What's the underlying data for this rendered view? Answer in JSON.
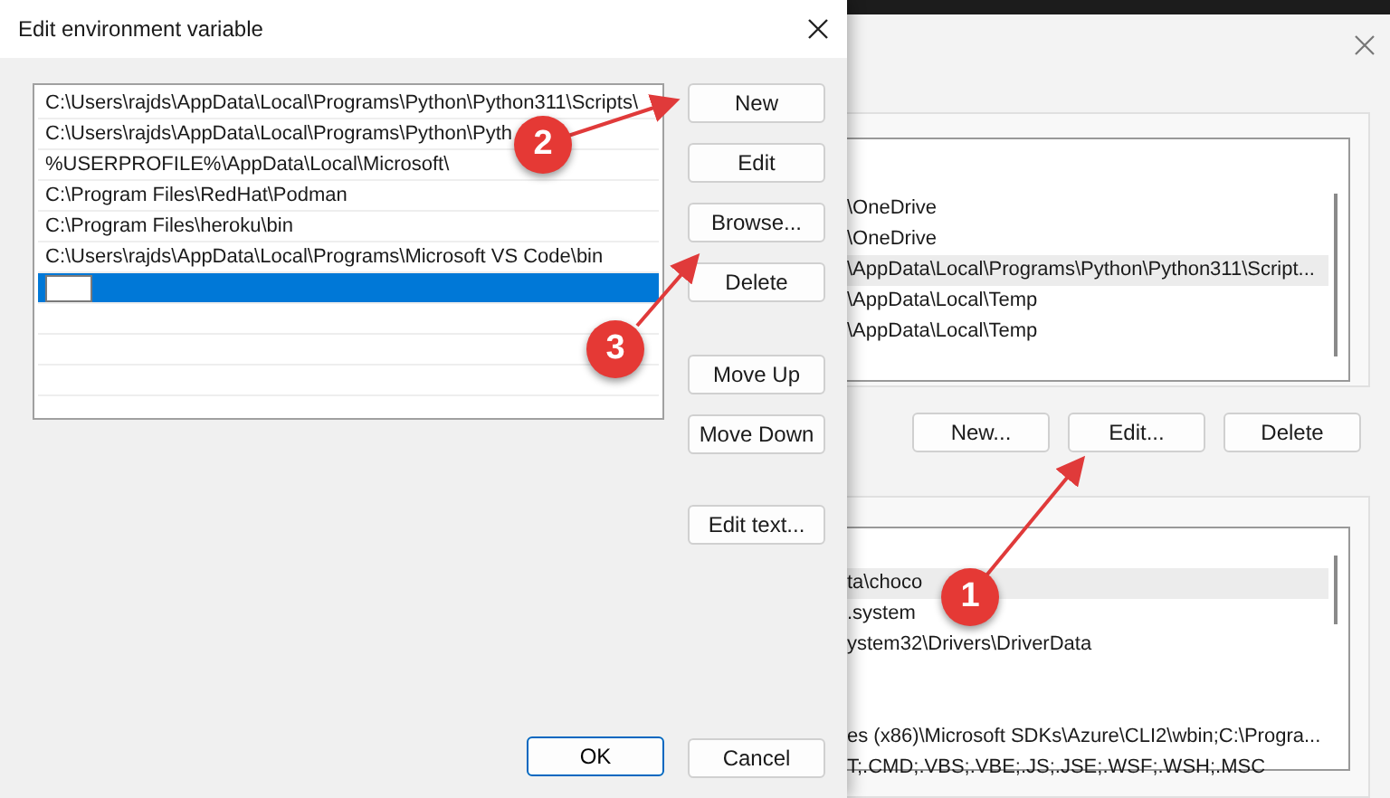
{
  "dialog": {
    "title": "Edit environment variable",
    "entries": [
      {
        "text": "C:\\Users\\rajds\\AppData\\Local\\Programs\\Python\\Python311\\Scripts\\",
        "selected": false
      },
      {
        "text": "C:\\Users\\rajds\\AppData\\Local\\Programs\\Python\\Pyth",
        "selected": false
      },
      {
        "text": "%USERPROFILE%\\AppData\\Local\\Microsoft\\",
        "selected": false
      },
      {
        "text": "C:\\Program Files\\RedHat\\Podman",
        "selected": false
      },
      {
        "text": "C:\\Program Files\\heroku\\bin",
        "selected": false
      },
      {
        "text": "C:\\Users\\rajds\\AppData\\Local\\Programs\\Microsoft VS Code\\bin",
        "selected": false
      },
      {
        "selected": true,
        "editing": true
      }
    ],
    "side_buttons": [
      "New",
      "Edit",
      "Browse...",
      "Delete",
      "Move Up",
      "Move Down",
      "Edit text..."
    ],
    "ok": "OK",
    "cancel": "Cancel"
  },
  "background_window": {
    "user_rows": [
      {
        "text": "\\OneDrive",
        "selected": false
      },
      {
        "text": "\\OneDrive",
        "selected": false
      },
      {
        "text": "\\AppData\\Local\\Programs\\Python\\Python311\\Script...",
        "selected": true
      },
      {
        "text": "\\AppData\\Local\\Temp",
        "selected": false
      },
      {
        "text": "\\AppData\\Local\\Temp",
        "selected": false
      }
    ],
    "buttons": [
      "New...",
      "Edit...",
      "Delete"
    ],
    "system_rows": [
      {
        "text": "ta\\choco",
        "selected": true
      },
      {
        "text": ".system",
        "selected": false
      },
      {
        "text": "ystem32\\Drivers\\DriverData",
        "selected": false
      },
      {
        "selected": false
      },
      {
        "selected": false
      },
      {
        "text": "es (x86)\\Microsoft SDKs\\Azure\\CLI2\\wbin;C:\\Progra...",
        "selected": false
      },
      {
        "text": "T;.CMD;.VBS;.VBE;.JS;.JSE;.WSF;.WSH;.MSC",
        "selected": false
      }
    ]
  },
  "annotations": [
    "1",
    "2",
    "3"
  ]
}
